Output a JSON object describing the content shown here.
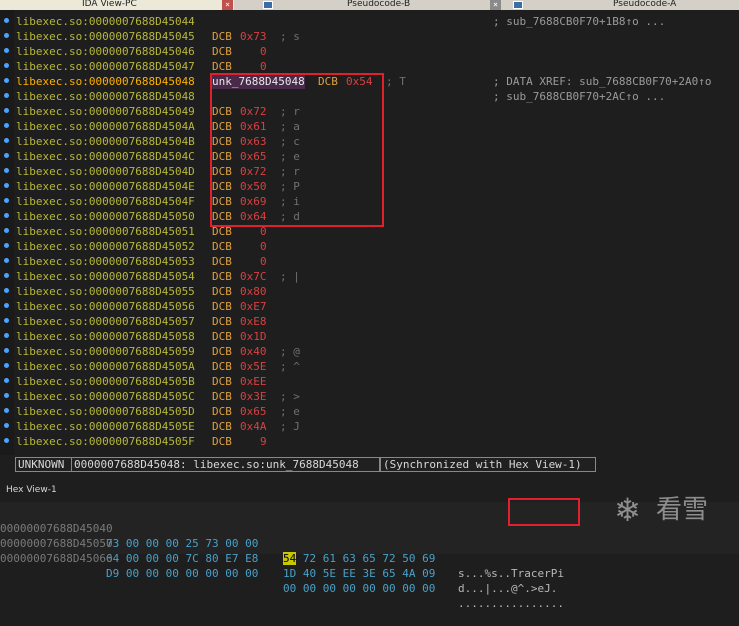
{
  "tabs": [
    {
      "label": "IDA View-PC",
      "active": true
    },
    {
      "label": "Pseudocode-B",
      "active": false
    },
    {
      "label": "Pseudocode-A",
      "active": false
    }
  ],
  "listing": [
    {
      "addr": "libexec.so:0000007688D45044",
      "kw": "",
      "val": "",
      "cmt": "",
      "xref": "; sub_7688CB0F70+1B8↑o ..."
    },
    {
      "addr": "libexec.so:0000007688D45045",
      "kw": "DCB",
      "val": "0x73",
      "cmt": "; s",
      "xref": ""
    },
    {
      "addr": "libexec.so:0000007688D45046",
      "kw": "DCB",
      "val": "0",
      "cmt": "",
      "xref": ""
    },
    {
      "addr": "libexec.so:0000007688D45047",
      "kw": "DCB",
      "val": "0",
      "cmt": "",
      "xref": ""
    },
    {
      "addr": "libexec.so:0000007688D45048",
      "label": "unk_7688D45048",
      "kw": "DCB",
      "val": "0x54",
      "cmt": "; T",
      "xref": "; DATA XREF: sub_7688CB0F70+2A0↑o"
    },
    {
      "addr": "libexec.so:0000007688D45048",
      "kw": "",
      "val": "",
      "cmt": "",
      "xref": "; sub_7688CB0F70+2AC↑o ..."
    },
    {
      "addr": "libexec.so:0000007688D45049",
      "kw": "DCB",
      "val": "0x72",
      "cmt": "; r",
      "xref": ""
    },
    {
      "addr": "libexec.so:0000007688D4504A",
      "kw": "DCB",
      "val": "0x61",
      "cmt": "; a",
      "xref": ""
    },
    {
      "addr": "libexec.so:0000007688D4504B",
      "kw": "DCB",
      "val": "0x63",
      "cmt": "; c",
      "xref": ""
    },
    {
      "addr": "libexec.so:0000007688D4504C",
      "kw": "DCB",
      "val": "0x65",
      "cmt": "; e",
      "xref": ""
    },
    {
      "addr": "libexec.so:0000007688D4504D",
      "kw": "DCB",
      "val": "0x72",
      "cmt": "; r",
      "xref": ""
    },
    {
      "addr": "libexec.so:0000007688D4504E",
      "kw": "DCB",
      "val": "0x50",
      "cmt": "; P",
      "xref": ""
    },
    {
      "addr": "libexec.so:0000007688D4504F",
      "kw": "DCB",
      "val": "0x69",
      "cmt": "; i",
      "xref": ""
    },
    {
      "addr": "libexec.so:0000007688D45050",
      "kw": "DCB",
      "val": "0x64",
      "cmt": "; d",
      "xref": ""
    },
    {
      "addr": "libexec.so:0000007688D45051",
      "kw": "DCB",
      "val": "0",
      "cmt": "",
      "xref": ""
    },
    {
      "addr": "libexec.so:0000007688D45052",
      "kw": "DCB",
      "val": "0",
      "cmt": "",
      "xref": ""
    },
    {
      "addr": "libexec.so:0000007688D45053",
      "kw": "DCB",
      "val": "0",
      "cmt": "",
      "xref": ""
    },
    {
      "addr": "libexec.so:0000007688D45054",
      "kw": "DCB",
      "val": "0x7C",
      "cmt": "; |",
      "xref": ""
    },
    {
      "addr": "libexec.so:0000007688D45055",
      "kw": "DCB",
      "val": "0x80",
      "cmt": "",
      "xref": ""
    },
    {
      "addr": "libexec.so:0000007688D45056",
      "kw": "DCB",
      "val": "0xE7",
      "cmt": "",
      "xref": ""
    },
    {
      "addr": "libexec.so:0000007688D45057",
      "kw": "DCB",
      "val": "0xE8",
      "cmt": "",
      "xref": ""
    },
    {
      "addr": "libexec.so:0000007688D45058",
      "kw": "DCB",
      "val": "0x1D",
      "cmt": "",
      "xref": ""
    },
    {
      "addr": "libexec.so:0000007688D45059",
      "kw": "DCB",
      "val": "0x40",
      "cmt": "; @",
      "xref": ""
    },
    {
      "addr": "libexec.so:0000007688D4505A",
      "kw": "DCB",
      "val": "0x5E",
      "cmt": "; ^",
      "xref": ""
    },
    {
      "addr": "libexec.so:0000007688D4505B",
      "kw": "DCB",
      "val": "0xEE",
      "cmt": "",
      "xref": ""
    },
    {
      "addr": "libexec.so:0000007688D4505C",
      "kw": "DCB",
      "val": "0x3E",
      "cmt": "; >",
      "xref": ""
    },
    {
      "addr": "libexec.so:0000007688D4505D",
      "kw": "DCB",
      "val": "0x65",
      "cmt": "; e",
      "xref": ""
    },
    {
      "addr": "libexec.so:0000007688D4505E",
      "kw": "DCB",
      "val": "0x4A",
      "cmt": "; J",
      "xref": ""
    },
    {
      "addr": "libexec.so:0000007688D4505F",
      "kw": "DCB",
      "val": "9",
      "cmt": "",
      "xref": ""
    }
  ],
  "status": {
    "segment": "UNKNOWN",
    "location": "0000007688D45048: libexec.so:unk_7688D45048",
    "sync": "(Synchronized with Hex View-1)"
  },
  "hexview": {
    "title": "Hex View-1",
    "rows": [
      {
        "addr": "00000007688D45040",
        "bytes1": "73 00 00 00 25 73 00 00",
        "bytes2": "54 72 61 63 65 72 50 69",
        "ascii": "s...%s..TracerPi"
      },
      {
        "addr": "00000007688D45050",
        "bytes1": "64 00 00 00 7C 80 E7 E8",
        "bytes2": "1D 40 5E EE 3E 65 4A 09",
        "ascii": "d...|...@^.>eJ."
      },
      {
        "addr": "00000007688D45060",
        "bytes1": "D9 00 00 00 00 00 00 00",
        "bytes2": "00 00 00 00 00 00 00 00",
        "ascii": "................"
      }
    ]
  },
  "watermark": {
    "icon": "snowflake-icon",
    "text": "看雪"
  }
}
